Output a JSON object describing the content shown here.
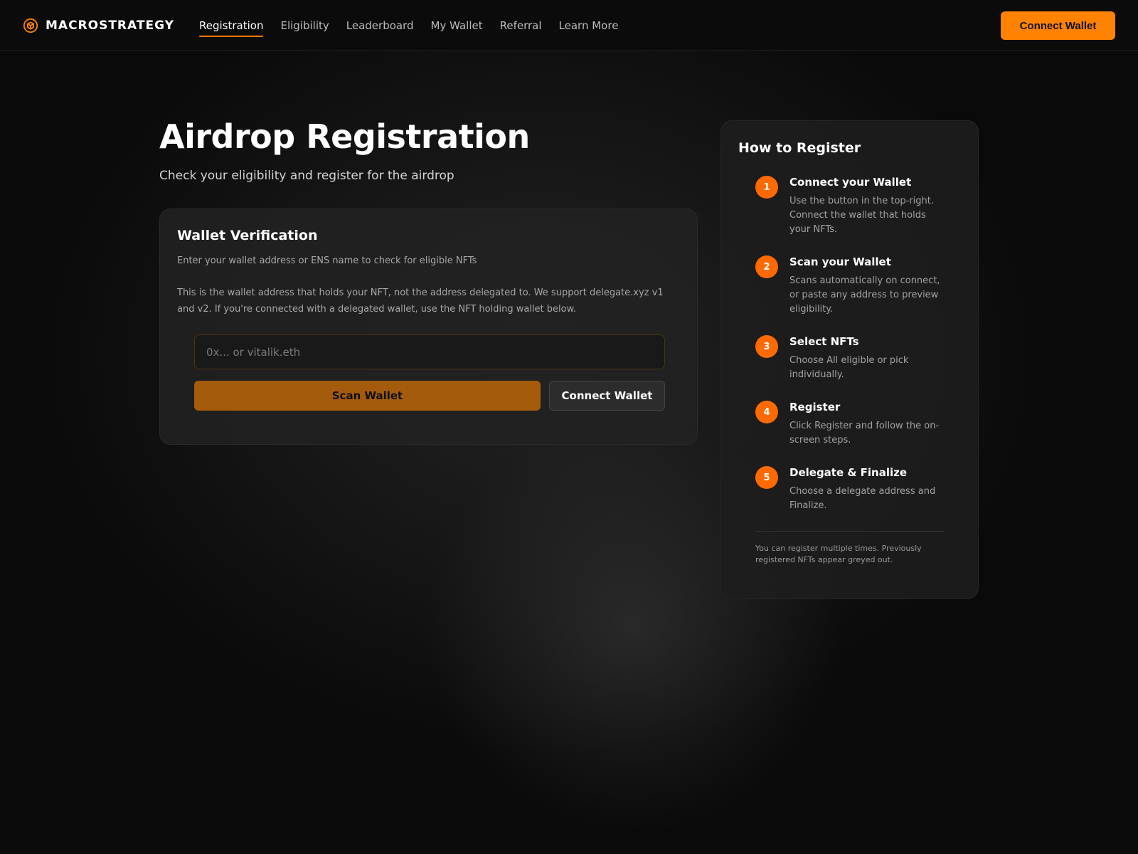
{
  "brand": {
    "name": "MACROSTRATEGY",
    "accent_color": "#ff8200"
  },
  "nav": {
    "items": [
      {
        "label": "Registration",
        "active": true
      },
      {
        "label": "Eligibility",
        "active": false
      },
      {
        "label": "Leaderboard",
        "active": false
      },
      {
        "label": "My Wallet",
        "active": false
      },
      {
        "label": "Referral",
        "active": false
      },
      {
        "label": "Learn More",
        "active": false
      }
    ]
  },
  "header": {
    "connect_label": "Connect Wallet"
  },
  "hero": {
    "title": "Airdrop Registration",
    "subtitle": "Check your eligibility and register for the airdrop"
  },
  "wallet_card": {
    "title": "Wallet Verification",
    "lead": "Enter your wallet address or ENS name to check for eligible NFTs",
    "note": "This is the wallet address that holds your NFT, not the address delegated to. We support delegate.xyz v1 and v2. If you're connected with a delegated wallet, use the NFT holding wallet below.",
    "input_value": "",
    "input_placeholder": "0x... or vitalik.eth",
    "scan_label": "Scan Wallet",
    "connect_label": "Connect Wallet"
  },
  "howto": {
    "title": "How to Register",
    "steps": [
      {
        "num": "1",
        "title": "Connect your Wallet",
        "desc": "Use the button in the top-right. Connect the wallet that holds your NFTs."
      },
      {
        "num": "2",
        "title": "Scan your Wallet",
        "desc": "Scans automatically on connect, or paste any address to preview eligibility."
      },
      {
        "num": "3",
        "title": "Select NFTs",
        "desc": "Choose All eligible or pick individually."
      },
      {
        "num": "4",
        "title": "Register",
        "desc": "Click Register and follow the on-screen steps."
      },
      {
        "num": "5",
        "title": "Delegate & Finalize",
        "desc": "Choose a delegate address and Finalize."
      }
    ],
    "footnote": "You can register multiple times. Previously registered NFTs appear greyed out."
  }
}
